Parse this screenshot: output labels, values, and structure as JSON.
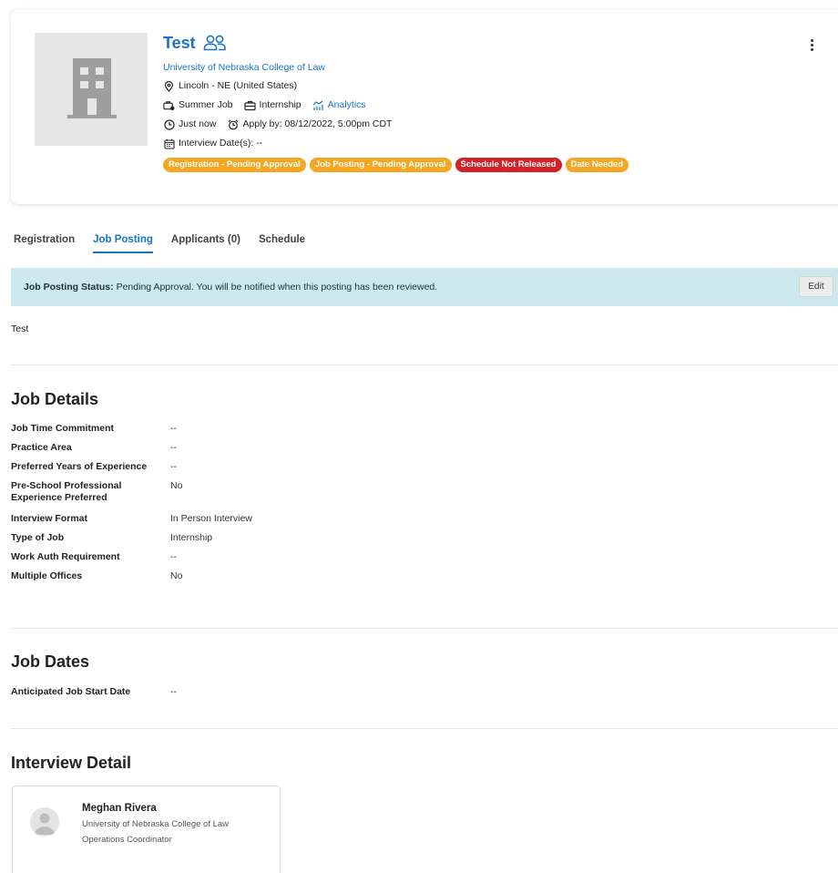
{
  "header": {
    "title": "Test",
    "organization": "University of Nebraska College of Law",
    "location": "Lincoln - NE (United States)",
    "job_type": "Summer Job",
    "job_category": "Internship",
    "analytics_label": "Analytics",
    "posted": "Just now",
    "apply_by": "Apply by: 08/12/2022, 5:00pm CDT",
    "interview_dates": "Interview Date(s): --",
    "badges": [
      {
        "label": "Registration - Pending Approval",
        "color": "#f5a623"
      },
      {
        "label": "Job Posting - Pending Approval",
        "color": "#f5a623"
      },
      {
        "label": "Schedule Not Released",
        "color": "#d3222a"
      },
      {
        "label": "Date Needed",
        "color": "#f5a623"
      }
    ]
  },
  "tabs": [
    {
      "label": "Registration",
      "active": false
    },
    {
      "label": "Job Posting",
      "active": true
    },
    {
      "label": "Applicants (0)",
      "active": false
    },
    {
      "label": "Schedule",
      "active": false
    }
  ],
  "status": {
    "label": "Job Posting Status:",
    "message": "Pending Approval. You will be notified when this posting has been reviewed.",
    "edit_label": "Edit",
    "background": "#cde9ed"
  },
  "description": "Test",
  "job_details": {
    "heading": "Job Details",
    "rows": [
      {
        "key": "Job Time Commitment",
        "value": "--"
      },
      {
        "key": "Practice Area",
        "value": "--"
      },
      {
        "key": "Preferred Years of Experience",
        "value": "--"
      },
      {
        "key": "Pre-School Professional Experience Preferred",
        "value": "No"
      },
      {
        "key": "Interview Format",
        "value": "In Person Interview"
      },
      {
        "key": "Type of Job",
        "value": "Internship"
      },
      {
        "key": "Work Auth Requirement",
        "value": "--"
      },
      {
        "key": "Multiple Offices",
        "value": "No"
      }
    ]
  },
  "job_dates": {
    "heading": "Job Dates",
    "rows": [
      {
        "key": "Anticipated Job Start Date",
        "value": "--"
      }
    ]
  },
  "interview_detail": {
    "heading": "Interview Detail",
    "contact": {
      "name": "Meghan Rivera",
      "organization": "University of Nebraska College of Law",
      "role": "Operations Coordinator"
    }
  },
  "colors": {
    "link": "#1a73c8",
    "badge_orange": "#f5a623",
    "badge_red": "#d3222a"
  }
}
